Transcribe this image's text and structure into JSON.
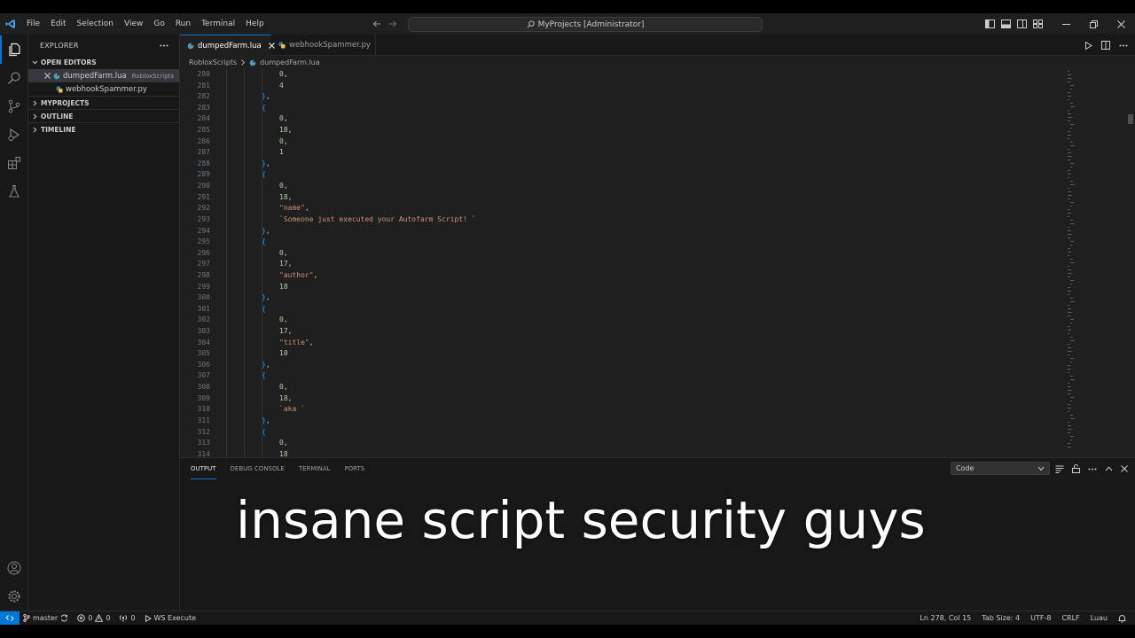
{
  "window": {
    "title": "MyProjects [Administrator]"
  },
  "menu": [
    "File",
    "Edit",
    "Selection",
    "View",
    "Go",
    "Run",
    "Terminal",
    "Help"
  ],
  "sidebar": {
    "title": "EXPLORER",
    "sections": {
      "open_editors": "OPEN EDITORS",
      "myprojects": "MYPROJECTS",
      "outline": "OUTLINE",
      "timeline": "TIMELINE"
    },
    "open_editors": [
      {
        "name": "dumpedFarm.lua",
        "description": "RobloxScripts"
      },
      {
        "name": "webhookSpammer.py",
        "description": ""
      }
    ]
  },
  "tabs": [
    {
      "label": "dumpedFarm.lua"
    },
    {
      "label": "webhookSpammer.py"
    }
  ],
  "breadcrumb": [
    "RobloxScripts",
    "dumpedFarm.lua"
  ],
  "editor": {
    "lines": [
      {
        "n": "280",
        "indent": 2,
        "t": "0,"
      },
      {
        "n": "281",
        "indent": 2,
        "t": "4"
      },
      {
        "n": "282",
        "indent": 1,
        "t": "},"
      },
      {
        "n": "283",
        "indent": 1,
        "t": "{"
      },
      {
        "n": "284",
        "indent": 2,
        "t": "0,"
      },
      {
        "n": "285",
        "indent": 2,
        "t": "18,"
      },
      {
        "n": "286",
        "indent": 2,
        "t": "0,"
      },
      {
        "n": "287",
        "indent": 2,
        "t": "1"
      },
      {
        "n": "288",
        "indent": 1,
        "t": "},"
      },
      {
        "n": "289",
        "indent": 1,
        "t": "{"
      },
      {
        "n": "290",
        "indent": 2,
        "t": "0,"
      },
      {
        "n": "291",
        "indent": 2,
        "t": "18,"
      },
      {
        "n": "292",
        "indent": 2,
        "t": "\"name\","
      },
      {
        "n": "293",
        "indent": 2,
        "t": "`Someone just executed your Autofarm Script! `"
      },
      {
        "n": "294",
        "indent": 1,
        "t": "},"
      },
      {
        "n": "295",
        "indent": 1,
        "t": "{"
      },
      {
        "n": "296",
        "indent": 2,
        "t": "0,"
      },
      {
        "n": "297",
        "indent": 2,
        "t": "17,"
      },
      {
        "n": "298",
        "indent": 2,
        "t": "\"author\","
      },
      {
        "n": "299",
        "indent": 2,
        "t": "18"
      },
      {
        "n": "300",
        "indent": 1,
        "t": "},"
      },
      {
        "n": "301",
        "indent": 1,
        "t": "{"
      },
      {
        "n": "302",
        "indent": 2,
        "t": "0,"
      },
      {
        "n": "303",
        "indent": 2,
        "t": "17,"
      },
      {
        "n": "304",
        "indent": 2,
        "t": "\"title\","
      },
      {
        "n": "305",
        "indent": 2,
        "t": "10"
      },
      {
        "n": "306",
        "indent": 1,
        "t": "},"
      },
      {
        "n": "307",
        "indent": 1,
        "t": "{"
      },
      {
        "n": "308",
        "indent": 2,
        "t": "0,"
      },
      {
        "n": "309",
        "indent": 2,
        "t": "18,"
      },
      {
        "n": "310",
        "indent": 2,
        "t": "`aka `"
      },
      {
        "n": "311",
        "indent": 1,
        "t": "},"
      },
      {
        "n": "312",
        "indent": 1,
        "t": "{"
      },
      {
        "n": "313",
        "indent": 2,
        "t": "0,"
      },
      {
        "n": "314",
        "indent": 2,
        "t": "18"
      }
    ]
  },
  "panel": {
    "tabs": [
      "OUTPUT",
      "DEBUG CONSOLE",
      "TERMINAL",
      "PORTS"
    ],
    "active_tab": "OUTPUT",
    "channel": "Code",
    "caption": "insane script security guys"
  },
  "statusbar": {
    "branch": "master",
    "errors": "0",
    "warnings": "0",
    "ports": "0",
    "extension": "WS Execute",
    "cursor": "Ln 278, Col 15",
    "tab_size": "Tab Size: 4",
    "encoding": "UTF-8",
    "eol": "CRLF",
    "language": "Luau"
  },
  "colors": {
    "accent": "#0078d4",
    "number": "#b5cea8",
    "string": "#ce9178",
    "bracket": "#179fff",
    "lua_icon": "#519aba"
  }
}
